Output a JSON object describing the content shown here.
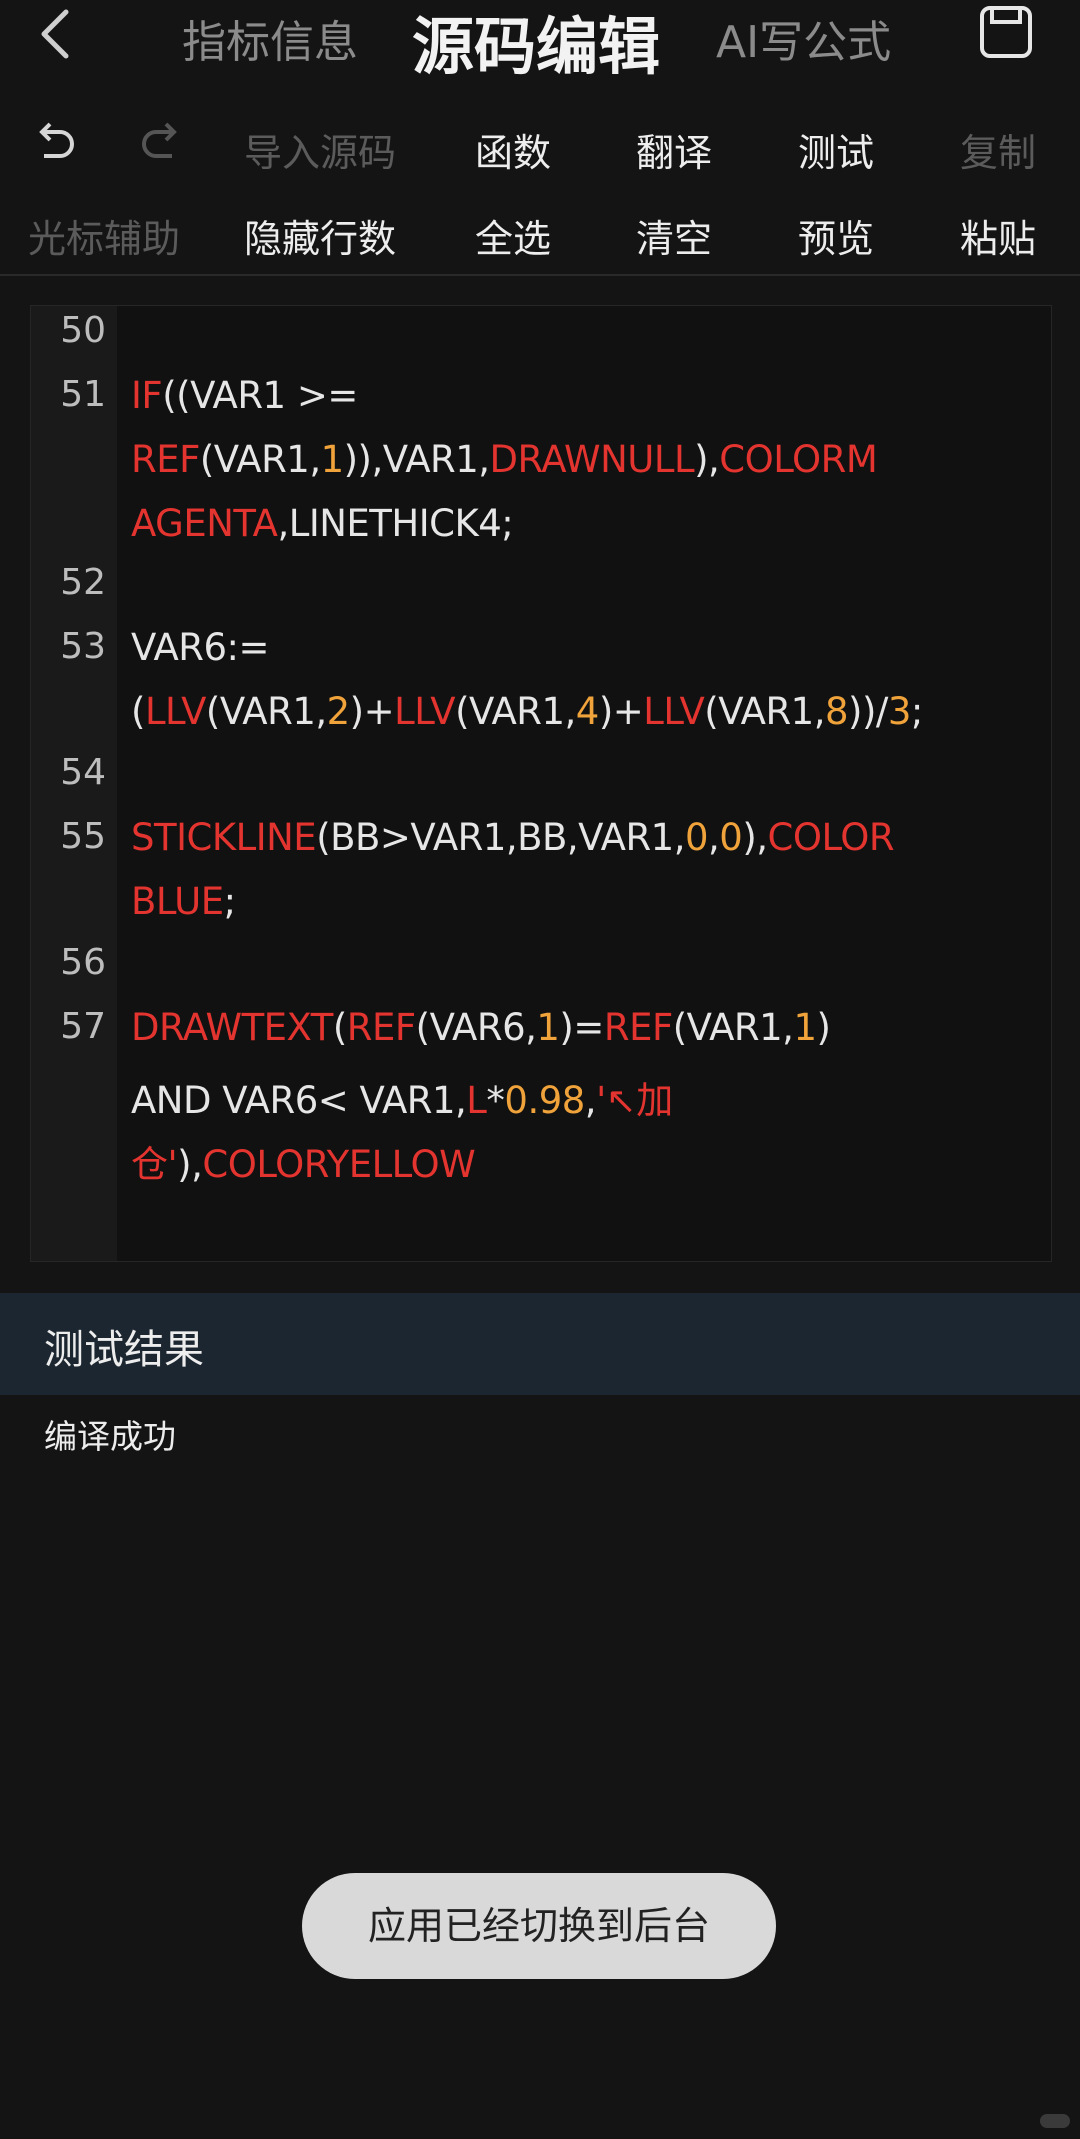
{
  "header": {
    "tabs": [
      "指标信息",
      "源码编辑",
      "AI写公式"
    ],
    "active_tab": "源码编辑",
    "back_icon": "chevron-left-icon",
    "save_icon": "save-icon"
  },
  "toolbar": {
    "undo_icon": "undo-icon",
    "redo_icon": "redo-icon",
    "row1": [
      "导入源码",
      "函数",
      "翻译",
      "测试",
      "复制"
    ],
    "row2": [
      "光标辅助",
      "隐藏行数",
      "全选",
      "清空",
      "预览",
      "粘贴"
    ]
  },
  "editor": {
    "line_numbers": [
      "50",
      "51",
      "52",
      "53",
      "54",
      "55",
      "56",
      "57"
    ],
    "code_lines": [
      [],
      [
        {
          "t": "IF",
          "c": "kw"
        },
        {
          "t": "((VAR1 >=",
          "c": ""
        }
      ],
      [
        {
          "t": "REF",
          "c": "kw"
        },
        {
          "t": "(VAR1,",
          "c": ""
        },
        {
          "t": "1",
          "c": "num"
        },
        {
          "t": ")),VAR1,",
          "c": ""
        },
        {
          "t": "DRAWNULL",
          "c": "kw"
        },
        {
          "t": "),",
          "c": ""
        },
        {
          "t": "COLORM",
          "c": "kw"
        }
      ],
      [
        {
          "t": "AGENTA",
          "c": "kw"
        },
        {
          "t": ",LINETHICK4;",
          "c": ""
        }
      ],
      [],
      [
        {
          "t": "VAR6:=",
          "c": ""
        }
      ],
      [
        {
          "t": "(",
          "c": ""
        },
        {
          "t": "LLV",
          "c": "kw"
        },
        {
          "t": "(VAR1,",
          "c": ""
        },
        {
          "t": "2",
          "c": "num"
        },
        {
          "t": ")+",
          "c": ""
        },
        {
          "t": "LLV",
          "c": "kw"
        },
        {
          "t": "(VAR1,",
          "c": ""
        },
        {
          "t": "4",
          "c": "num"
        },
        {
          "t": ")+",
          "c": ""
        },
        {
          "t": "LLV",
          "c": "kw"
        },
        {
          "t": "(VAR1,",
          "c": ""
        },
        {
          "t": "8",
          "c": "num"
        },
        {
          "t": "))/",
          "c": ""
        },
        {
          "t": "3",
          "c": "num"
        },
        {
          "t": ";",
          "c": ""
        }
      ],
      [],
      [
        {
          "t": "STICKLINE",
          "c": "kw"
        },
        {
          "t": "(BB>VAR1,BB,VAR1,",
          "c": ""
        },
        {
          "t": "0",
          "c": "num"
        },
        {
          "t": ",",
          "c": ""
        },
        {
          "t": "0",
          "c": "num"
        },
        {
          "t": "),",
          "c": ""
        },
        {
          "t": "COLOR",
          "c": "kw"
        }
      ],
      [
        {
          "t": "BLUE",
          "c": "kw"
        },
        {
          "t": ";",
          "c": ""
        }
      ],
      [],
      [
        {
          "t": "DRAWTEXT",
          "c": "kw"
        },
        {
          "t": "(",
          "c": ""
        },
        {
          "t": "REF",
          "c": "kw"
        },
        {
          "t": "(VAR6,",
          "c": ""
        },
        {
          "t": "1",
          "c": "num"
        },
        {
          "t": ")=",
          "c": ""
        },
        {
          "t": "REF",
          "c": "kw"
        },
        {
          "t": "(VAR1,",
          "c": ""
        },
        {
          "t": "1",
          "c": "num"
        },
        {
          "t": ")",
          "c": ""
        }
      ],
      [
        {
          "t": "AND VAR6< VAR1,",
          "c": ""
        },
        {
          "t": "L",
          "c": "kw"
        },
        {
          "t": "*",
          "c": ""
        },
        {
          "t": "0.98",
          "c": "num"
        },
        {
          "t": ",",
          "c": ""
        },
        {
          "t": "'↖加",
          "c": "str"
        }
      ],
      [
        {
          "t": "仓'",
          "c": "str"
        },
        {
          "t": "),",
          "c": ""
        },
        {
          "t": "COLORYELLOW",
          "c": "kw"
        }
      ]
    ]
  },
  "result": {
    "title": "测试结果",
    "text": "编译成功"
  },
  "toast": "应用已经切换到后台"
}
